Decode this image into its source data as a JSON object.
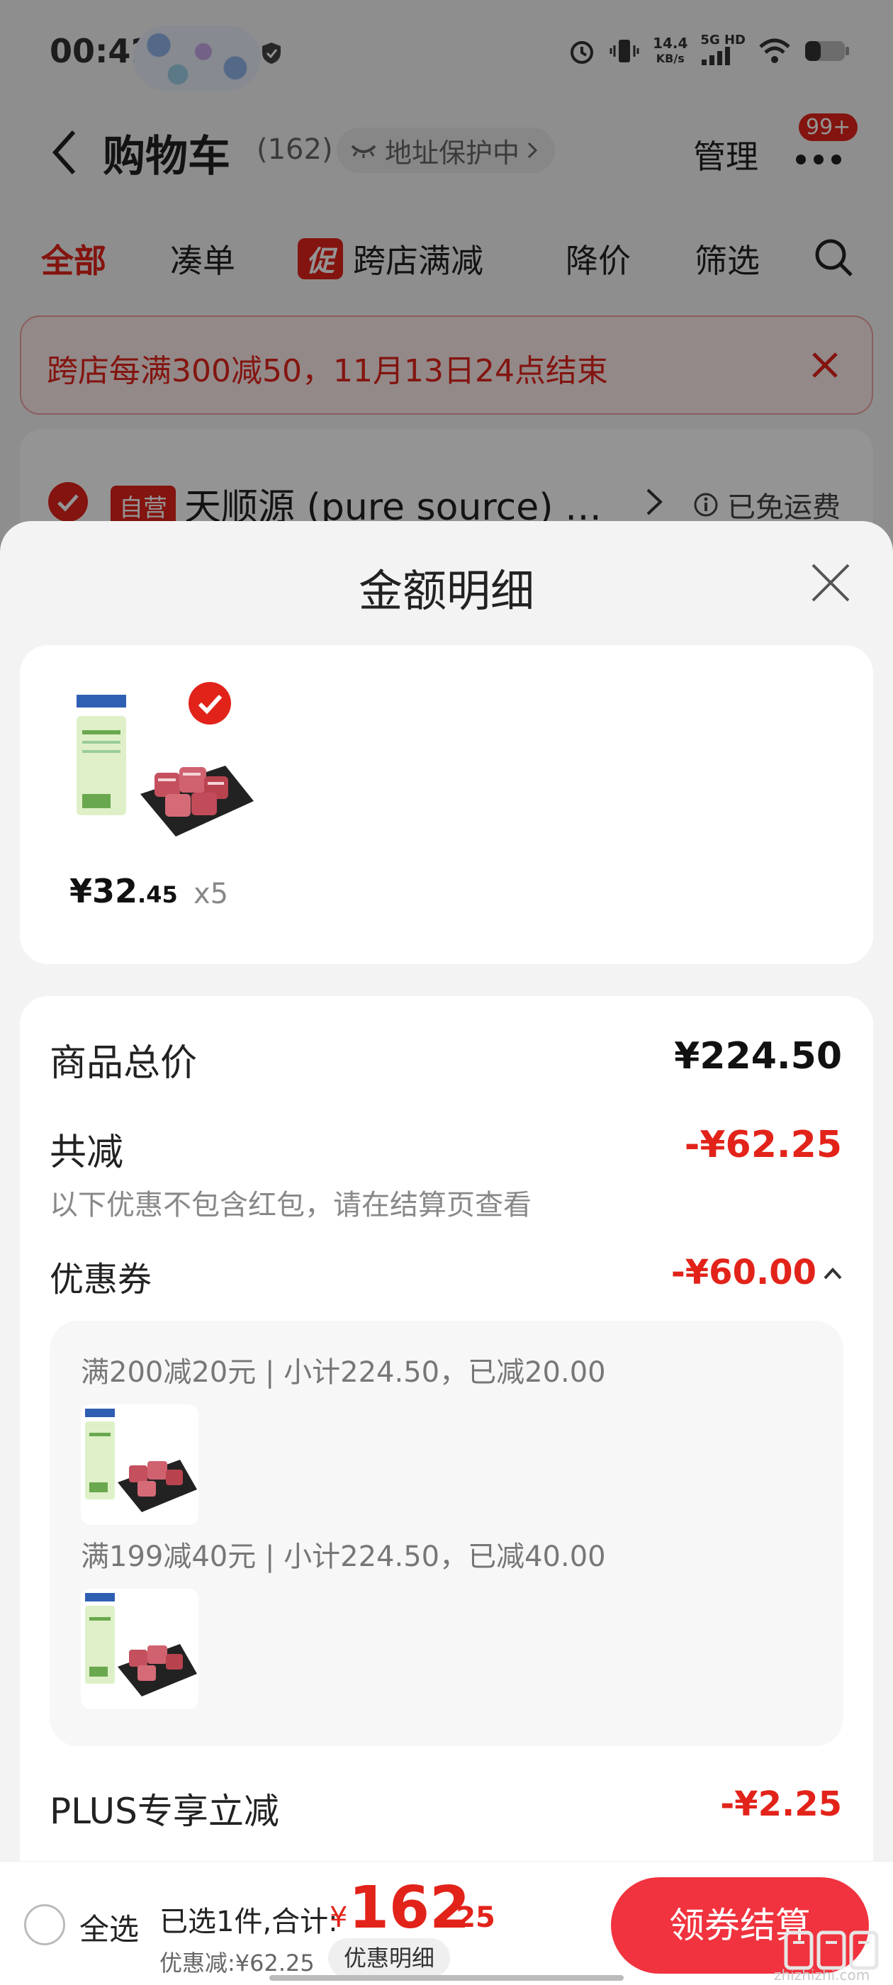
{
  "status_bar": {
    "time": "00:42",
    "speed_value": "14.4",
    "speed_unit": "KB/s",
    "network": "5G HD"
  },
  "header": {
    "title": "购物车",
    "count": "(162)",
    "address_label": "地址保护中",
    "manage_label": "管理",
    "badge": "99+"
  },
  "tabs": {
    "all": "全部",
    "combo": "凑单",
    "promo_tag": "促",
    "promo": "跨店满减",
    "price_drop": "降价",
    "filter": "筛选"
  },
  "promo_banner": {
    "text": "跨店每满300减50，11月13日24点结束"
  },
  "store": {
    "tag": "自营",
    "name": "天顺源 (pure source) …",
    "shipping": "已免运费"
  },
  "sheet": {
    "title": "金额明细",
    "product": {
      "price_int": "¥32",
      "price_dec": ".45",
      "qty": "x5"
    },
    "total_label": "商品总价",
    "total_value": "¥224.50",
    "reduce_label": "共减",
    "reduce_value": "-¥62.25",
    "reduce_note": "以下优惠不包含红包，请在结算页查看",
    "coupon_label": "优惠券",
    "coupon_value": "-¥60.00",
    "coupons": [
      {
        "text": "满200减20元 | 小计224.50，已减20.00"
      },
      {
        "text": "满199减40元 | 小计224.50，已减40.00"
      }
    ],
    "plus_label": "PLUS专享立减",
    "plus_value": "-¥2.25"
  },
  "bottom": {
    "select_all": "全选",
    "selected": "已选1件,合计:",
    "currency": "¥",
    "total_int": "162",
    "total_dec": ".25",
    "discount": "优惠减:¥62.25",
    "detail_button": "优惠明细",
    "checkout": "领券结算"
  },
  "watermark": "zhizhizhi.com",
  "colors": {
    "accent": "#e2231a",
    "checkout": "#f0333e"
  },
  "icons": [
    "back-icon",
    "search-icon",
    "more-icon",
    "close-icon",
    "check-icon",
    "chevron-up-icon",
    "info-icon"
  ]
}
